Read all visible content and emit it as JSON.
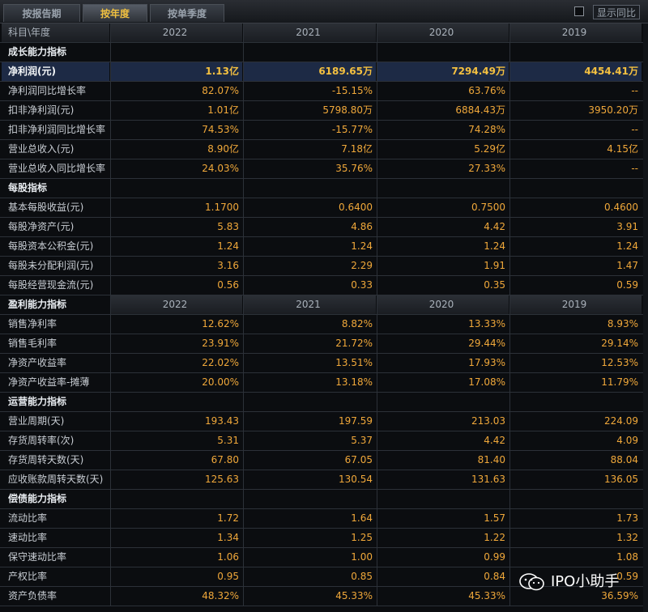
{
  "tabs": [
    "按报告期",
    "按年度",
    "按单季度"
  ],
  "compare_label": "显示同比",
  "header": {
    "label": "科目\\年度",
    "years": [
      "2022",
      "2021",
      "2020",
      "2019"
    ]
  },
  "rows": [
    {
      "type": "section",
      "label": "成长能力指标"
    },
    {
      "type": "data",
      "hl": true,
      "label": "净利润(元)",
      "values": [
        "1.13亿",
        "6189.65万",
        "7294.49万",
        "4454.41万"
      ]
    },
    {
      "type": "data",
      "label": "净利润同比增长率",
      "values": [
        "82.07%",
        "-15.15%",
        "63.76%",
        "--"
      ]
    },
    {
      "type": "data",
      "label": "扣非净利润(元)",
      "values": [
        "1.01亿",
        "5798.80万",
        "6884.43万",
        "3950.20万"
      ]
    },
    {
      "type": "data",
      "label": "扣非净利润同比增长率",
      "values": [
        "74.53%",
        "-15.77%",
        "74.28%",
        "--"
      ]
    },
    {
      "type": "data",
      "label": "营业总收入(元)",
      "values": [
        "8.90亿",
        "7.18亿",
        "5.29亿",
        "4.15亿"
      ]
    },
    {
      "type": "data",
      "label": "营业总收入同比增长率",
      "values": [
        "24.03%",
        "35.76%",
        "27.33%",
        "--"
      ]
    },
    {
      "type": "section",
      "label": "每股指标"
    },
    {
      "type": "data",
      "label": "基本每股收益(元)",
      "values": [
        "1.1700",
        "0.6400",
        "0.7500",
        "0.4600"
      ]
    },
    {
      "type": "data",
      "label": "每股净资产(元)",
      "values": [
        "5.83",
        "4.86",
        "4.42",
        "3.91"
      ]
    },
    {
      "type": "data",
      "label": "每股资本公积金(元)",
      "values": [
        "1.24",
        "1.24",
        "1.24",
        "1.24"
      ]
    },
    {
      "type": "data",
      "label": "每股未分配利润(元)",
      "values": [
        "3.16",
        "2.29",
        "1.91",
        "1.47"
      ]
    },
    {
      "type": "data",
      "label": "每股经营现金流(元)",
      "values": [
        "0.56",
        "0.33",
        "0.35",
        "0.59"
      ]
    },
    {
      "type": "hdr2",
      "label": "盈利能力指标",
      "values": [
        "2022",
        "2021",
        "2020",
        "2019"
      ]
    },
    {
      "type": "data",
      "label": "销售净利率",
      "values": [
        "12.62%",
        "8.82%",
        "13.33%",
        "8.93%"
      ]
    },
    {
      "type": "data",
      "label": "销售毛利率",
      "values": [
        "23.91%",
        "21.72%",
        "29.44%",
        "29.14%"
      ]
    },
    {
      "type": "data",
      "label": "净资产收益率",
      "values": [
        "22.02%",
        "13.51%",
        "17.93%",
        "12.53%"
      ]
    },
    {
      "type": "data",
      "label": "净资产收益率-摊薄",
      "values": [
        "20.00%",
        "13.18%",
        "17.08%",
        "11.79%"
      ]
    },
    {
      "type": "section",
      "label": "运营能力指标"
    },
    {
      "type": "data",
      "label": "营业周期(天)",
      "values": [
        "193.43",
        "197.59",
        "213.03",
        "224.09"
      ]
    },
    {
      "type": "data",
      "label": "存货周转率(次)",
      "values": [
        "5.31",
        "5.37",
        "4.42",
        "4.09"
      ]
    },
    {
      "type": "data",
      "label": "存货周转天数(天)",
      "values": [
        "67.80",
        "67.05",
        "81.40",
        "88.04"
      ]
    },
    {
      "type": "data",
      "label": "应收账款周转天数(天)",
      "values": [
        "125.63",
        "130.54",
        "131.63",
        "136.05"
      ]
    },
    {
      "type": "section",
      "label": "偿债能力指标"
    },
    {
      "type": "data",
      "label": "流动比率",
      "values": [
        "1.72",
        "1.64",
        "1.57",
        "1.73"
      ]
    },
    {
      "type": "data",
      "label": "速动比率",
      "values": [
        "1.34",
        "1.25",
        "1.22",
        "1.32"
      ]
    },
    {
      "type": "data",
      "label": "保守速动比率",
      "values": [
        "1.06",
        "1.00",
        "0.99",
        "1.08"
      ]
    },
    {
      "type": "data",
      "label": "产权比率",
      "values": [
        "0.95",
        "0.85",
        "0.84",
        "0.59"
      ]
    },
    {
      "type": "data",
      "label": "资产负债率",
      "values": [
        "48.32%",
        "45.33%",
        "45.33%",
        "36.59%"
      ]
    }
  ],
  "watermark": "IPO小助手"
}
